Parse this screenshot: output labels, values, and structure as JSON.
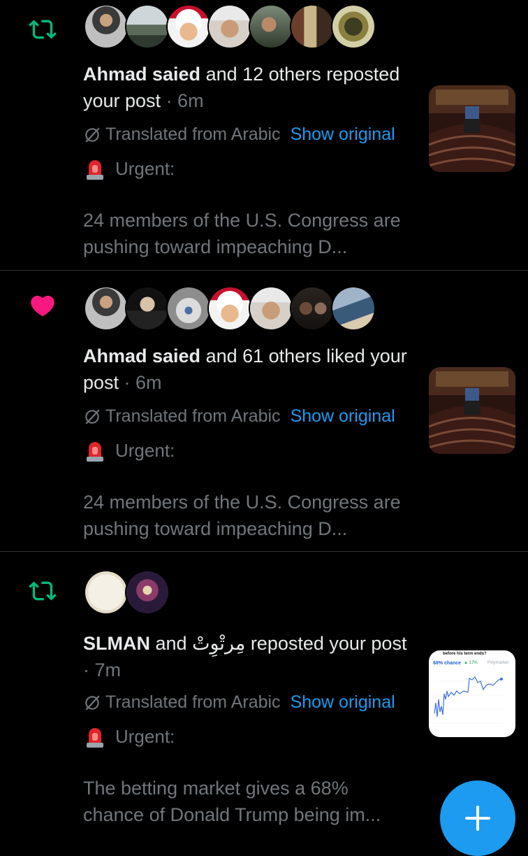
{
  "notifications": [
    {
      "type": "repost",
      "icon": "repost-icon",
      "actor": "Ahmad saied",
      "action_text": " and 12 others reposted your post",
      "time": " · 6m",
      "translated_label": "Translated from Arabic",
      "show_original": "Show original",
      "urgent_label": "Urgent:",
      "body": "24 members of the U.S. Congress are pushing toward impeaching D...",
      "avatar_count": 7
    },
    {
      "type": "like",
      "icon": "heart-icon",
      "actor": "Ahmad saied",
      "action_text": " and 61 others liked your post",
      "time": " · 6m",
      "translated_label": "Translated from Arabic",
      "show_original": "Show original",
      "urgent_label": "Urgent:",
      "body": "24 members of the U.S. Congress are pushing toward impeaching D...",
      "avatar_count": 7
    },
    {
      "type": "repost",
      "icon": "repost-icon",
      "actor": "SLMAN",
      "action_text": " and مِرتْوِتْ reposted your post",
      "time": " · 7m",
      "translated_label": "Translated from Arabic",
      "show_original": "Show original",
      "urgent_label": "Urgent:",
      "body": "The betting market gives a 68% chance of Donald Trump being im...",
      "avatar_count": 2
    }
  ],
  "thumb3": {
    "question": "before his term ends?",
    "chance": "68% chance",
    "delta": "▲ 17%",
    "source": "Polymarket"
  },
  "fab": {
    "icon": "plus-icon"
  },
  "colors": {
    "repost": "#00ba7c",
    "like": "#f91880",
    "link": "#1d9bf0",
    "secondary": "#71767b"
  }
}
